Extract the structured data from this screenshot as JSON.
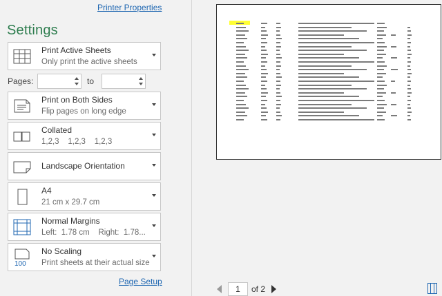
{
  "header": {
    "printer_properties": "Printer Properties",
    "settings_title": "Settings"
  },
  "settings": {
    "what": {
      "title": "Print Active Sheets",
      "subtitle": "Only print the active sheets",
      "icon": "sheets-grid-icon"
    },
    "pages": {
      "label": "Pages:",
      "to_label": "to",
      "from_value": "",
      "to_value": ""
    },
    "sides": {
      "title": "Print on Both Sides",
      "subtitle": "Flip pages on long edge",
      "icon": "duplex-icon"
    },
    "collation": {
      "title": "Collated",
      "subtitle": "1,2,3    1,2,3    1,2,3",
      "icon": "collated-icon"
    },
    "orientation": {
      "title": "Landscape Orientation",
      "icon": "landscape-icon"
    },
    "paper": {
      "title": "A4",
      "subtitle": "21 cm x 29.7 cm",
      "icon": "paper-size-icon"
    },
    "margins": {
      "title": "Normal Margins",
      "subtitle": "Left:  1.78 cm    Right:  1.78...",
      "icon": "margins-icon"
    },
    "scaling": {
      "title": "No Scaling",
      "subtitle": "Print sheets at their actual size",
      "icon": "scaling-icon",
      "icon_label": "100"
    },
    "page_setup": "Page Setup"
  },
  "preview_nav": {
    "current_page": "1",
    "of_text": "of 2"
  },
  "colors": {
    "accent_green": "#2e7d4f",
    "link_blue": "#1e66b1",
    "highlight": "#ffff33"
  }
}
